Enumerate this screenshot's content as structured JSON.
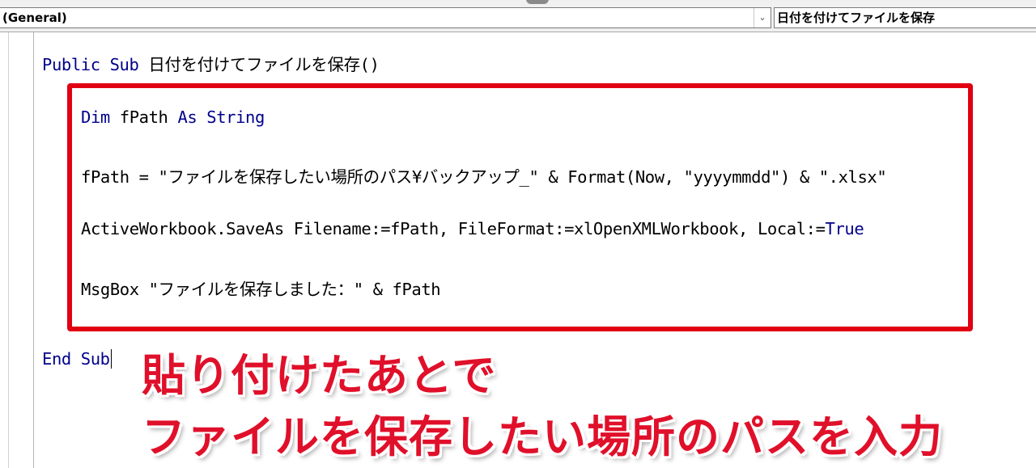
{
  "combo": {
    "object_value": "(General)",
    "procedure_value": "日付を付けてファイルを保存"
  },
  "code": {
    "line1": {
      "kw1": "Public Sub",
      "rest": " 日付を付けてファイルを保存()"
    },
    "line2": {
      "kw1": "Dim",
      "mid": " fPath ",
      "kw2": "As String"
    },
    "line3": "fPath = \"ファイルを保存したい場所のパス¥バックアップ_\" & Format(Now, \"yyyymmdd\") & \".xlsx\"",
    "line4": {
      "pre": "ActiveWorkbook.SaveAs Filename:=fPath, FileFormat:=xlOpenXMLWorkbook, Local:=",
      "kw": "True"
    },
    "line5": "MsgBox \"ファイルを保存しました：\" & fPath",
    "line6": {
      "kw": "End Sub"
    }
  },
  "annotation": {
    "line1": "貼り付けたあとで",
    "line2": "ファイルを保存したい場所のパスを入力"
  },
  "colors": {
    "keyword": "#00008b",
    "highlight_border": "#e00012",
    "annotation_text": "#e0102a"
  },
  "icons": {
    "combo_arrow": "chevron-down-icon"
  }
}
